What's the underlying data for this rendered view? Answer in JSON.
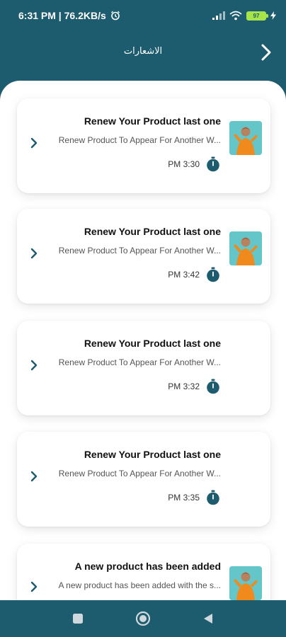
{
  "status_bar": {
    "time": "6:31 PM | 76.2KB/s",
    "battery": "97"
  },
  "header": {
    "title": "الاشعارات"
  },
  "notifications": [
    {
      "title": "Renew Your Product last one",
      "body": "Renew Product To Appear For Another W...",
      "time": "PM 3:30",
      "has_thumbnail": true
    },
    {
      "title": "Renew Your Product last one",
      "body": "Renew Product To Appear For Another W...",
      "time": "PM 3:42",
      "has_thumbnail": true
    },
    {
      "title": "Renew Your Product last one",
      "body": "Renew Product To Appear For Another W...",
      "time": "PM 3:32",
      "has_thumbnail": false
    },
    {
      "title": "Renew Your Product last one",
      "body": "Renew Product To Appear For Another W...",
      "time": "PM 3:35",
      "has_thumbnail": false
    },
    {
      "title": "A new product has been added",
      "body": "A new product has been added with the s...",
      "time": "",
      "has_thumbnail": true
    }
  ],
  "nav": {
    "icons": [
      "recent-apps-icon",
      "home-icon",
      "back-triangle-icon"
    ]
  },
  "colors": {
    "primary": "#1d5b6e",
    "card_bg": "#ffffff",
    "battery": "#a6e44a"
  }
}
